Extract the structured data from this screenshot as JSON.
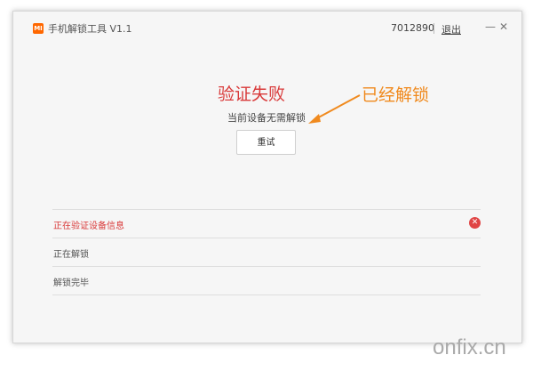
{
  "titlebar": {
    "logo_text": "MI",
    "app_title": "手机解锁工具  V1.1",
    "account_id": "7012890",
    "logout_label": "退出",
    "minimize_glyph": "—",
    "close_glyph": "✕"
  },
  "result": {
    "title": "验证失败",
    "description": "当前设备无需解锁",
    "retry_label": "重试"
  },
  "annotation": {
    "text": "已经解锁",
    "color": "#f08a1e"
  },
  "steps": [
    {
      "label": "正在验证设备信息",
      "status": "error"
    },
    {
      "label": "正在解锁",
      "status": "pending"
    },
    {
      "label": "解锁完毕",
      "status": "pending"
    }
  ],
  "status_icons": {
    "error": "x-circle-icon"
  },
  "watermark": "onfix.cn",
  "colors": {
    "error": "#d93a3a",
    "brand": "#ff6700"
  }
}
